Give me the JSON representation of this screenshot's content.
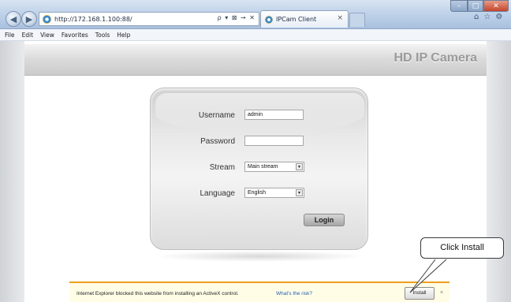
{
  "browser": {
    "address": "http://172.168.1.100:88/",
    "address_tools": "ρ ▾ ⊠ → ✕",
    "tab_title": "IPCam Client",
    "tab_close": "×",
    "menu": [
      "File",
      "Edit",
      "View",
      "Favorites",
      "Tools",
      "Help"
    ]
  },
  "page": {
    "header_title": "HD IP Camera"
  },
  "login": {
    "username_label": "Username",
    "username_value": "admin",
    "password_label": "Password",
    "password_value": "",
    "stream_label": "Stream",
    "stream_value": "Main stream",
    "language_label": "Language",
    "language_value": "English",
    "login_button": "Login"
  },
  "notification": {
    "message": "Internet Explorer blocked this website from installing an ActiveX control.",
    "link": "What's the risk?",
    "install_button": "Install",
    "close": "×",
    "accent_color": "#ef9f1e"
  },
  "callout": {
    "text": "Click Install"
  }
}
